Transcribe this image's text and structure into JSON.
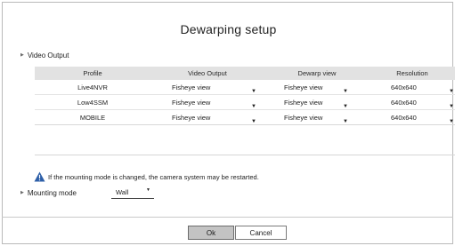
{
  "dialog": {
    "title": "Dewarping setup"
  },
  "video_output_section": {
    "label": "Video Output"
  },
  "table": {
    "headers": {
      "profile": "Profile",
      "video_output": "Video Output",
      "dewarp_view": "Dewarp view",
      "resolution": "Resolution"
    },
    "rows": [
      {
        "profile": "Live4NVR",
        "video_output": "Fisheye view",
        "dewarp_view": "Fisheye view",
        "resolution": "640x640"
      },
      {
        "profile": "Low4SSM",
        "video_output": "Fisheye view",
        "dewarp_view": "Fisheye view",
        "resolution": "640x640"
      },
      {
        "profile": "MOBILE",
        "video_output": "Fisheye view",
        "dewarp_view": "Fisheye view",
        "resolution": "640x640"
      }
    ],
    "dropdown_icon": "chevron-down-icon"
  },
  "warning": {
    "icon": "warning-triangle-icon",
    "text": "If the mounting mode is changed, the camera system may be restarted.",
    "icon_color": "#2d5fa8"
  },
  "mounting_mode": {
    "label": "Mounting mode",
    "value": "Wall"
  },
  "buttons": {
    "ok": "Ok",
    "cancel": "Cancel"
  }
}
